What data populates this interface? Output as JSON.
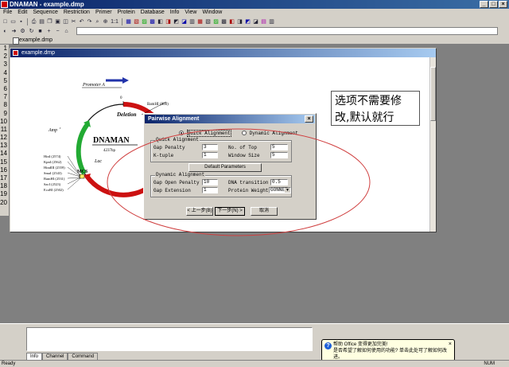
{
  "window": {
    "title": "DNAMAN - example.dmp",
    "min": "_",
    "max": "□",
    "close": "×"
  },
  "menu": [
    "File",
    "Edit",
    "Sequence",
    "Restriction",
    "Primer",
    "Protein",
    "Database",
    "Info",
    "View",
    "Window"
  ],
  "toolbar": {
    "icons": [
      "new-icon",
      "open-icon",
      "save-icon",
      "print-icon",
      "print-preview-icon",
      "copy-icon",
      "paste-icon",
      "find-icon",
      "cut-icon",
      "undo-icon",
      "redo-icon",
      "search-icon",
      "zoom-icon",
      "one-to-one-icon"
    ],
    "right_label": "1:1",
    "extra_icons": [
      "tool-a",
      "tool-b",
      "tool-c",
      "tool-d",
      "tool-e",
      "tool-f",
      "tool-g",
      "tool-h",
      "tool-i",
      "tool-j",
      "tool-k",
      "tool-l",
      "tool-m",
      "tool-n",
      "tool-o",
      "tool-p",
      "tool-q",
      "tool-r",
      "tool-s"
    ]
  },
  "file_tab": "example.dmp",
  "line_numbers": [
    "1",
    "2",
    "3",
    "4",
    "5",
    "6",
    "7",
    "8",
    "9",
    "10",
    "11",
    "12",
    "13",
    "14",
    "15",
    "16",
    "17",
    "18",
    "19",
    "20"
  ],
  "doc": {
    "title": "example.dmp"
  },
  "plasmid": {
    "name": "DNAMAN",
    "size": "4237bp",
    "labels": {
      "promoter": "Promoter A",
      "deletion": "Deletion",
      "amp": "Amp",
      "amp_sup": "r",
      "lac": "Lac",
      "mcs": "MCS",
      "bamhi": "BamHI (800)",
      "tick": "0"
    },
    "sites": [
      "HinI (2574)",
      "KpnI (2562)",
      "HindIII (2559)",
      "SmaI (2543)",
      "BamHI (2531)",
      "SacI (2523)",
      "EcoRI (2502)"
    ]
  },
  "dialog": {
    "title": "Pairwise Alignment",
    "radio_quick": "Quick Alignment",
    "radio_dynamic": "Dynamic Alignment",
    "quick_group": "Quick Alignment",
    "gap_penalty_label": "Gap Penalty",
    "gap_penalty": "3",
    "ktuple_label": "K-tuple",
    "ktuple": "1",
    "no_top_label": "No. of Top",
    "no_top": "5",
    "window_size_label": "Window Size",
    "window_size": "5",
    "default_btn": "Default Parameters",
    "dynamic_group": "Dynamic Alignment",
    "gap_open_label": "Gap Open Penalty",
    "gap_open": "10",
    "gap_ext_label": "Gap Extension",
    "gap_ext": "1",
    "dna_trans_label": "DNA transition",
    "dna_trans": "0.5",
    "prot_weight_label": "Protein Weight",
    "prot_weight": "GONNET",
    "back_btn": "< 上一步(B)",
    "next_btn": "下一步(N) >",
    "cancel_btn": "取消"
  },
  "annotation": {
    "line1": "选项不需要修",
    "line2": "改,默认就行"
  },
  "bottom_tabs": [
    "Info",
    "Channel",
    "Command"
  ],
  "assistant": {
    "title": "帮助 Office 变得更加完美!",
    "body": "是否希望了解如何使用的功能? 单击此处可了解如何改进。"
  },
  "status": {
    "left": "Ready",
    "right": "NUM"
  },
  "colors": {
    "ring_red": "#cc1111",
    "ring_green": "#22aa33",
    "arrow_blue": "#2233aa",
    "ellipse": "#d04040"
  }
}
